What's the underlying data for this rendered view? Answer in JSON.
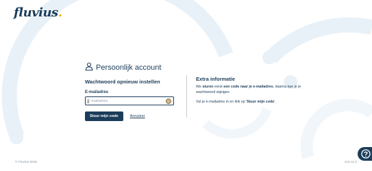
{
  "brand": {
    "logo_text": "fluvius",
    "accent": "#f2a900",
    "primary": "#1c3d5a"
  },
  "login": {
    "title": "Persoonlijk account",
    "title_icon": "user-icon",
    "subtitle": "Wachtwoord opnieuw instellen",
    "email_label": "E-mailadres",
    "email_placeholder": "E-mailadres",
    "email_value": "",
    "submit_label": "Stuur mijn code",
    "cancel_label": "Annuleer"
  },
  "info": {
    "title": "Extra informatie",
    "p1_a": "We ",
    "p1_b": "sturen",
    "p1_c": " eerst ",
    "p1_d": "een code naar je e-mailadres",
    "p1_e": ", daarna kan je je wachtwoord wijzigen.",
    "p2_a": "Vul je e-mailadres in en klik op '",
    "p2_b": "Stuur mijn code",
    "p2_c": "'."
  },
  "footer": {
    "copyright": "© Fluvius 2025",
    "version": "v15.11.0"
  },
  "help": {
    "icon": "help-icon"
  }
}
